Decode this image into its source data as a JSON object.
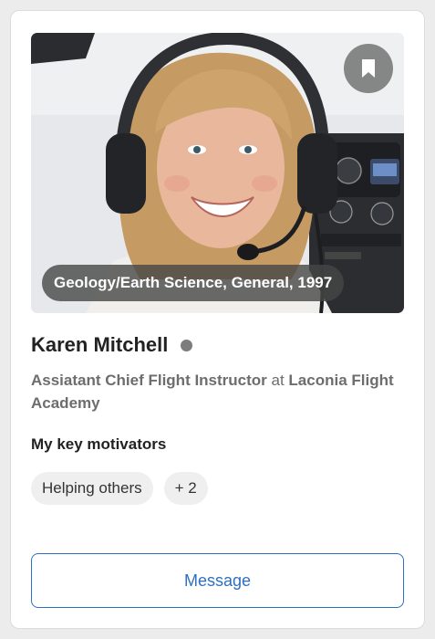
{
  "profile": {
    "degree": "Geology/Earth Science, General, 1997",
    "name": "Karen Mitchell",
    "role_title": "Assiatant Chief Flight Instructor",
    "role_connector": " at ",
    "organization": "Laconia Flight Academy"
  },
  "motivators": {
    "title": "My key motivators",
    "items": [
      "Helping others",
      "+ 2"
    ]
  },
  "actions": {
    "message_label": "Message"
  },
  "icons": {
    "bookmark": "bookmark-icon"
  },
  "colors": {
    "accent": "#2d6fc2",
    "status_dot": "#7d7d7d"
  }
}
